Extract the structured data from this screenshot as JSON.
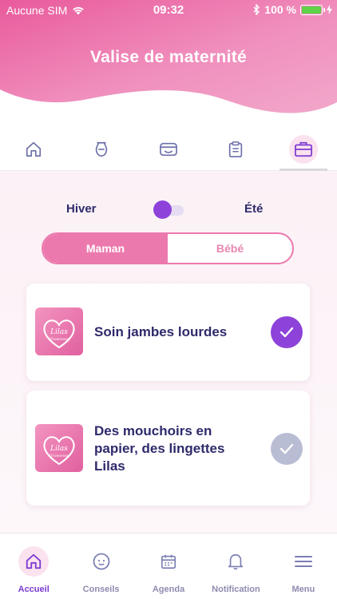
{
  "status": {
    "carrier": "Aucune SIM",
    "time": "09:32",
    "battery": "100 %",
    "battery_level": 1.0
  },
  "header": {
    "title": "Valise de maternité"
  },
  "colors": {
    "brand_pink": "#ec79ad",
    "accent_purple": "#8d42d9",
    "text_navy": "#2e2a6b",
    "nav_grey": "#8e8bb0"
  },
  "tabs": [
    {
      "icon": "home-icon",
      "active": false
    },
    {
      "icon": "baby-bottle-icon",
      "active": false
    },
    {
      "icon": "diaper-icon",
      "active": false
    },
    {
      "icon": "clipboard-icon",
      "active": false
    },
    {
      "icon": "suitcase-icon",
      "active": true
    }
  ],
  "season": {
    "left": "Hiver",
    "right": "Été",
    "selected": "Hiver"
  },
  "segment": {
    "option1": "Maman",
    "option2": "Bébé",
    "selected": "Maman"
  },
  "items": [
    {
      "logo_text": "Lilas Grossesse",
      "label": "Soin jambes lourdes",
      "checked": true
    },
    {
      "logo_text": "Lilas Grossesse",
      "label": "Des mouchoirs en papier, des lingettes Lilas",
      "checked": false
    }
  ],
  "nav": [
    {
      "label": "Accueil",
      "icon": "home-icon",
      "active": true
    },
    {
      "label": "Conseils",
      "icon": "baby-face-icon",
      "active": false
    },
    {
      "label": "Agenda",
      "icon": "calendar-icon",
      "active": false
    },
    {
      "label": "Notification",
      "icon": "bell-icon",
      "active": false
    },
    {
      "label": "Menu",
      "icon": "hamburger-icon",
      "active": false
    }
  ]
}
